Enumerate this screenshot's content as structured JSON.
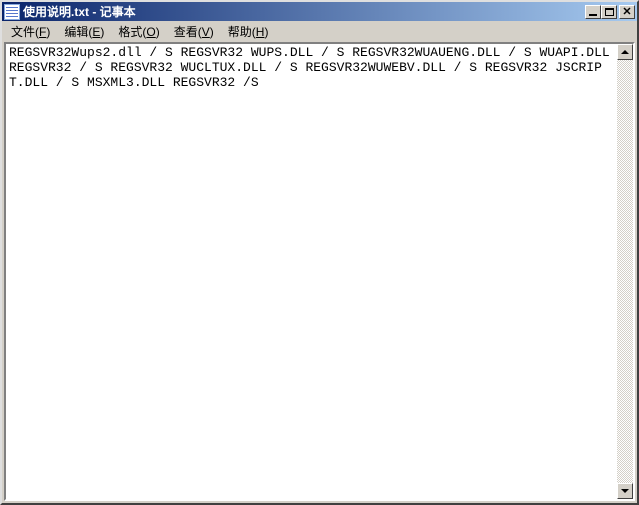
{
  "title": "使用说明.txt - 记事本",
  "menu": {
    "file": {
      "label": "文件",
      "accel": "F"
    },
    "edit": {
      "label": "编辑",
      "accel": "E"
    },
    "format": {
      "label": "格式",
      "accel": "O"
    },
    "view": {
      "label": "查看",
      "accel": "V"
    },
    "help": {
      "label": "帮助",
      "accel": "H"
    }
  },
  "content": "REGSVR32Wups2.dll / S REGSVR32 WUPS.DLL / S REGSVR32WUAUENG.DLL / S WUAPI.DLL REGSVR32 / S REGSVR32 WUCLTUX.DLL / S REGSVR32WUWEBV.DLL / S REGSVR32 JSCRIPT.DLL / S MSXML3.DLL REGSVR32 /S"
}
